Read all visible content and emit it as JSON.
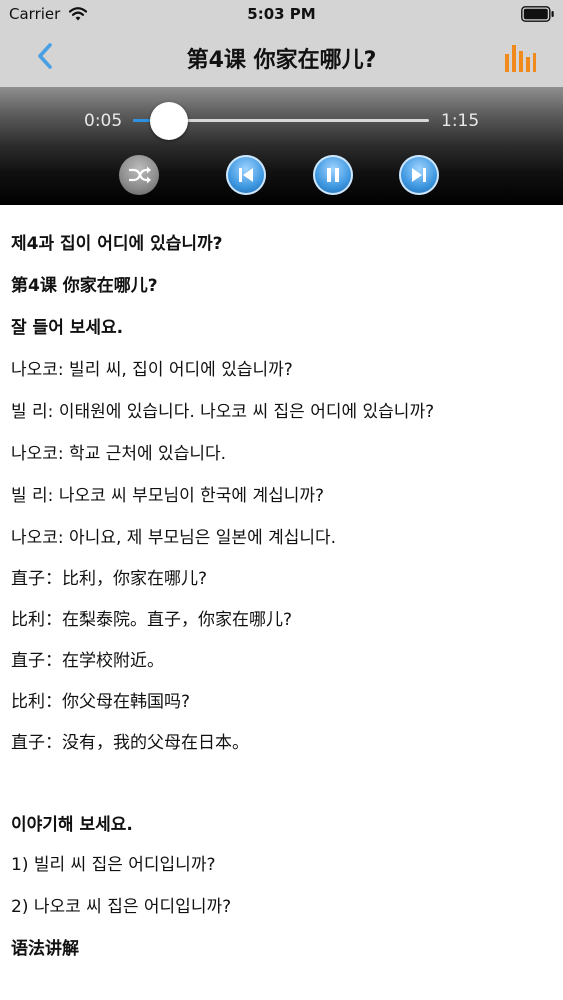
{
  "status_bar": {
    "carrier": "Carrier",
    "time": "5:03 PM",
    "icons": [
      "wifi-icon",
      "battery-icon"
    ]
  },
  "nav": {
    "title": "第4课 你家在哪儿?",
    "back_icon": "chevron-left-icon",
    "playlist_icon": "bar-chart-icon",
    "accent_color": "#4a9fe3",
    "playlist_color": "#f08a1c"
  },
  "player": {
    "current_time": "0:05",
    "total_time": "1:15",
    "progress_fraction": 0.067,
    "controls": [
      "shuffle-icon",
      "previous-track-icon",
      "pause-icon",
      "next-track-icon"
    ]
  },
  "content": {
    "lines": [
      {
        "text": "제4과 집이 어디에 있습니까?",
        "bold": true
      },
      {
        "text": "第4课 你家在哪儿?",
        "bold": true
      },
      {
        "text": "잘 들어 보세요.",
        "bold": true
      },
      {
        "text": "나오코: 빌리 씨, 집이 어디에 있습니까?",
        "bold": false
      },
      {
        "text": "빌 리: 이태원에 있습니다. 나오코 씨 집은 어디에 있습니까?",
        "bold": false
      },
      {
        "text": "나오코: 학교 근처에 있습니다.",
        "bold": false
      },
      {
        "text": "빌 리: 나오코 씨 부모님이 한국에 계십니까?",
        "bold": false
      },
      {
        "text": "나오코: 아니요, 제 부모님은 일본에 계십니다.",
        "bold": false
      },
      {
        "text": "直子：比利，你家在哪儿?",
        "bold": false
      },
      {
        "text": "比利：在梨泰院。直子，你家在哪儿?",
        "bold": false
      },
      {
        "text": "直子：在学校附近。",
        "bold": false
      },
      {
        "text": "比利：你父母在韩国吗?",
        "bold": false
      },
      {
        "text": "直子：没有，我的父母在日本。",
        "bold": false
      },
      {
        "text": "",
        "bold": false
      },
      {
        "text": "이야기해 보세요.",
        "bold": true
      },
      {
        "text": "1) 빌리 씨 집은 어디입니까?",
        "bold": false
      },
      {
        "text": "2) 나오코 씨 집은 어디입니까?",
        "bold": false
      },
      {
        "text": "语法讲解",
        "bold": true
      }
    ]
  }
}
